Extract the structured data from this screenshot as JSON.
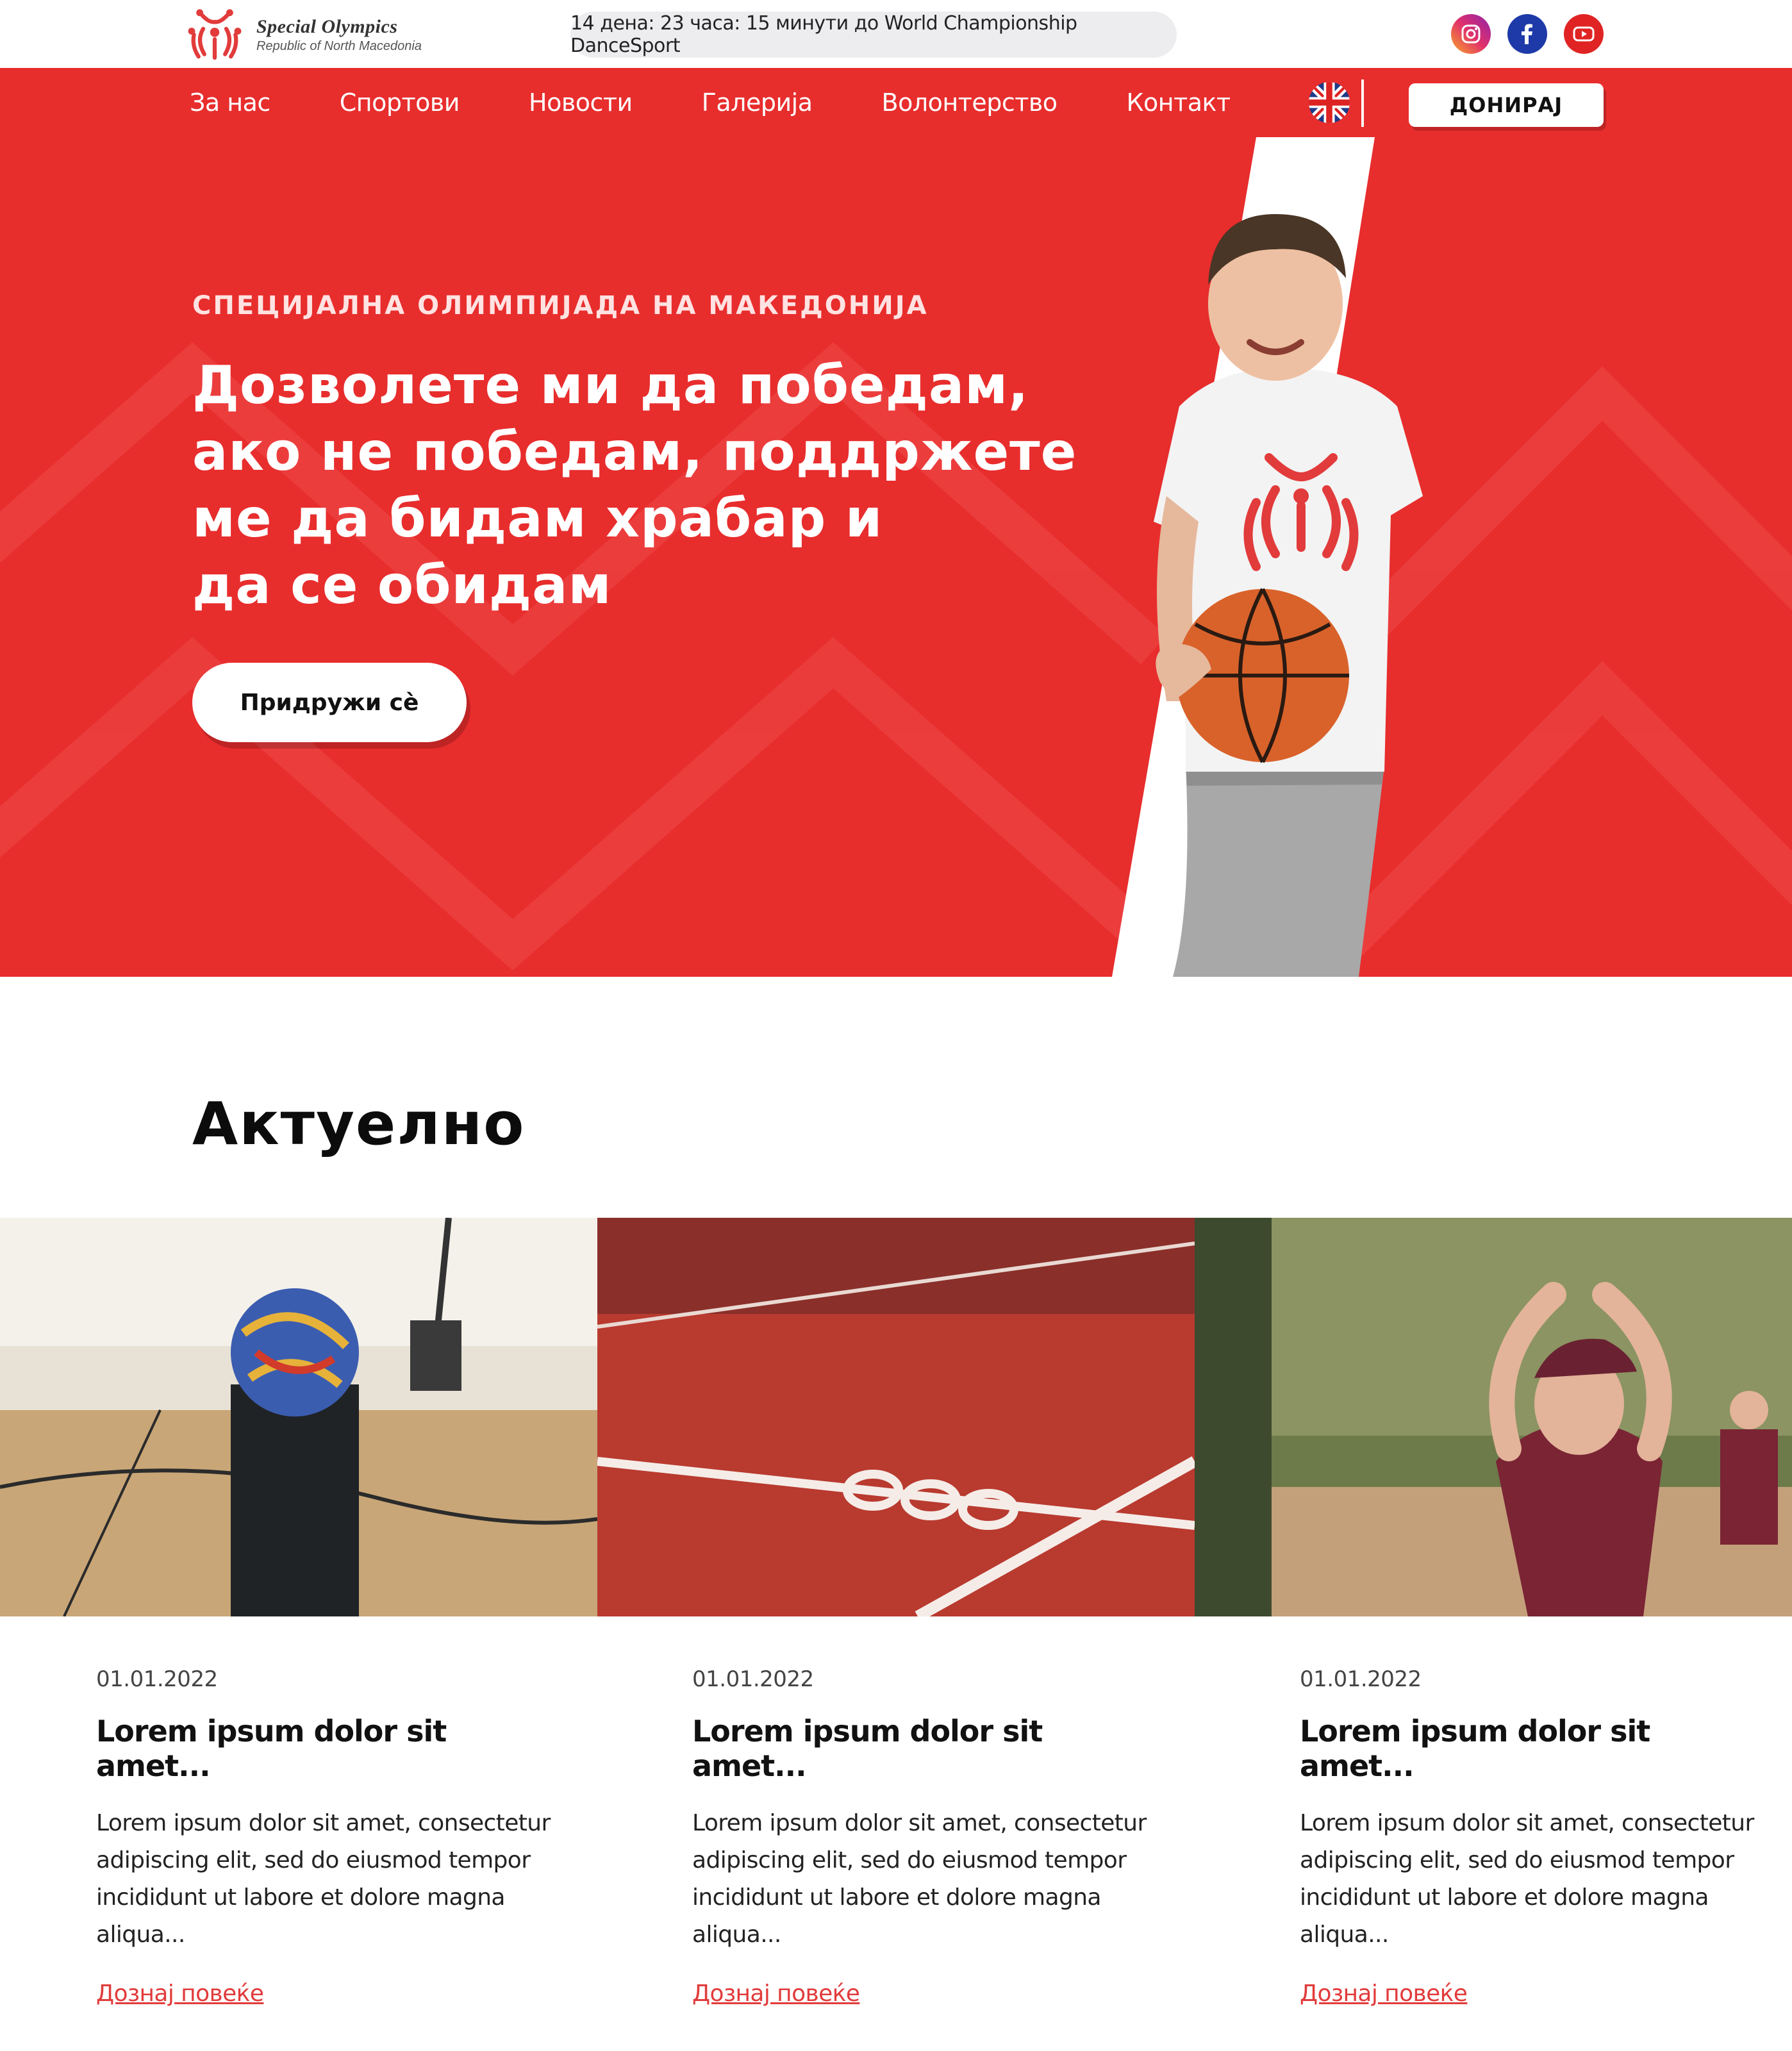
{
  "brand": {
    "title": "Special Olympics",
    "subtitle": "Republic of North Macedonia",
    "accent_color": "#e82d2d"
  },
  "countdown": {
    "text": "14 дена: 23 часа: 15 минути до World Championship DanceSport"
  },
  "socials": [
    {
      "name": "instagram-icon"
    },
    {
      "name": "facebook-icon"
    },
    {
      "name": "youtube-icon"
    }
  ],
  "nav": {
    "items": [
      "За нас",
      "Спортови",
      "Новости",
      "Галерија",
      "Волонтерство",
      "Контакт"
    ],
    "language_icon": "uk-flag-icon",
    "donate_label": "ДОНИРАЈ"
  },
  "hero": {
    "eyebrow": "СПЕЦИЈАЛНА ОЛИМПИЈАДА НА МАКЕДОНИЈА",
    "title_lines": [
      "Дозволете ми да победам,",
      "ако не победам, поддржете",
      "ме да бидам храбар и",
      "да се обидам"
    ],
    "cta_label": "Придружи сè"
  },
  "news": {
    "title": "Актуелно",
    "cards": [
      {
        "image": "basketball-gym-photo",
        "date": "01.01.2022",
        "title": "Lorem ipsum dolor sit amet...",
        "text": "Lorem ipsum dolor sit amet, consectetur adipiscing elit, sed do eiusmod tempor incididunt ut labore et dolore magna aliqua...",
        "link": "Дознај повеќе"
      },
      {
        "image": "running-track-800-photo",
        "date": "01.01.2022",
        "title": "Lorem ipsum dolor sit amet...",
        "text": "Lorem ipsum dolor sit amet, consectetur adipiscing elit, sed do eiusmod tempor incididunt ut labore et dolore magna aliqua...",
        "link": "Дознај повеќе"
      },
      {
        "image": "softball-athlete-photo",
        "date": "01.01.2022",
        "title": "Lorem ipsum dolor sit amet...",
        "text": "Lorem ipsum dolor sit amet, consectetur adipiscing elit, sed do eiusmod tempor incididunt ut labore et dolore magna aliqua...",
        "link": "Дознај повеќе"
      }
    ]
  }
}
